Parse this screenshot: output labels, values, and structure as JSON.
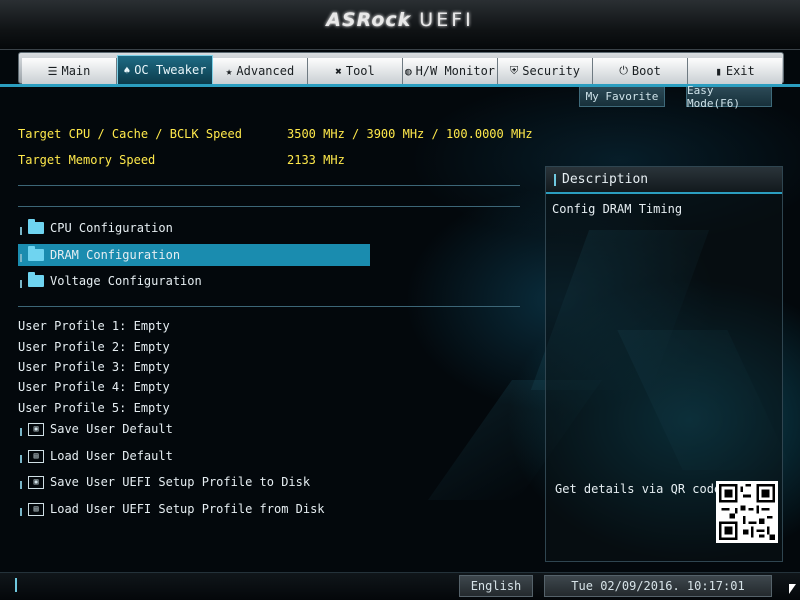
{
  "app": {
    "brand": "ASRock",
    "product": "UEFI"
  },
  "tabs": [
    {
      "label": "Main",
      "icon": "list-icon",
      "glyph": "☰"
    },
    {
      "label": "OC Tweaker",
      "icon": "flame-icon",
      "glyph": "♠"
    },
    {
      "label": "Advanced",
      "icon": "star-icon",
      "glyph": "★"
    },
    {
      "label": "Tool",
      "icon": "tools-icon",
      "glyph": "✖"
    },
    {
      "label": "H/W Monitor",
      "icon": "monitor-icon",
      "glyph": "◍"
    },
    {
      "label": "Security",
      "icon": "shield-icon",
      "glyph": "⛨"
    },
    {
      "label": "Boot",
      "icon": "power-icon",
      "glyph": "⏻"
    },
    {
      "label": "Exit",
      "icon": "exit-icon",
      "glyph": "▮"
    }
  ],
  "toolbar": {
    "favorite": "My Favorite",
    "easy_mode": "Easy Mode(F6)"
  },
  "targets": [
    {
      "label": "Target CPU / Cache / BCLK Speed",
      "value": "3500 MHz / 3900 MHz / 100.0000 MHz"
    },
    {
      "label": "Target Memory Speed",
      "value": "2133 MHz"
    }
  ],
  "config_items": [
    {
      "label": "CPU Configuration"
    },
    {
      "label": "DRAM Configuration"
    },
    {
      "label": "Voltage Configuration"
    }
  ],
  "profiles": [
    "User Profile 1: Empty",
    "User Profile 2: Empty",
    "User Profile 3: Empty",
    "User Profile 4: Empty",
    "User Profile 5: Empty"
  ],
  "actions": [
    {
      "label": "Save User Default",
      "icon": "save-icon"
    },
    {
      "label": "Load User Default",
      "icon": "load-icon"
    },
    {
      "label": "Save User UEFI Setup Profile to Disk",
      "icon": "save-disk-icon"
    },
    {
      "label": "Load User UEFI Setup Profile from Disk",
      "icon": "load-disk-icon"
    }
  ],
  "description": {
    "title": "Description",
    "text": "Config DRAM Timing",
    "qr_text": "Get details via QR code"
  },
  "status": {
    "language": "English",
    "datetime": "Tue 02/09/2016. 10:17:01"
  },
  "colors": {
    "accent": "#2b9ec0",
    "selected": "#1a8caf",
    "highlight_text": "#ffe94b"
  }
}
